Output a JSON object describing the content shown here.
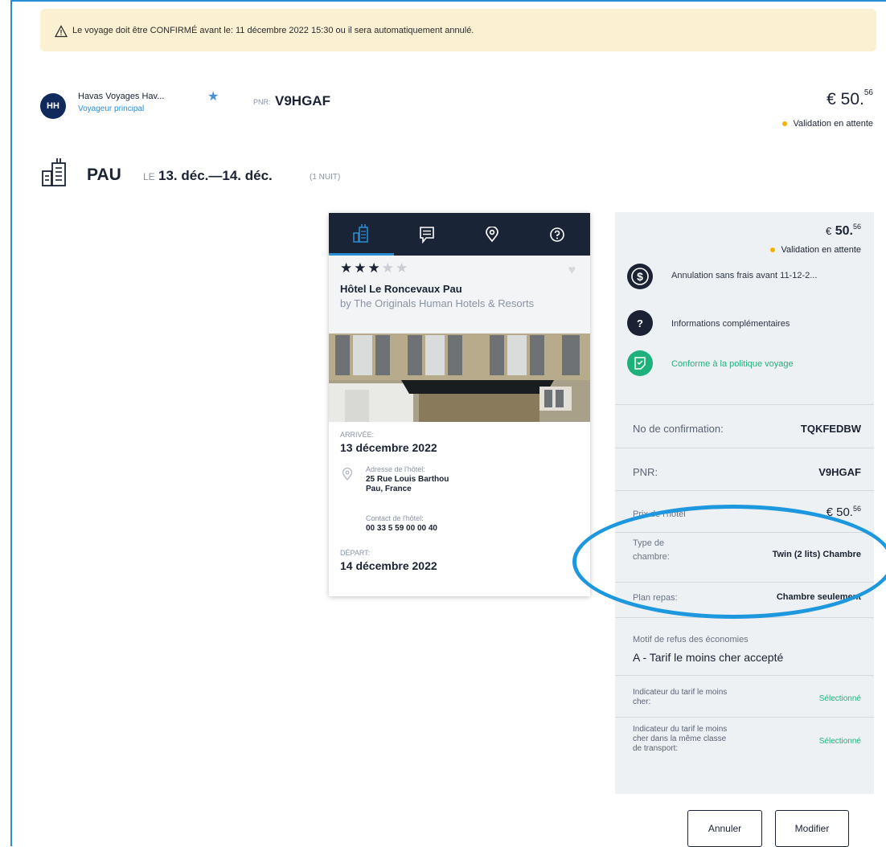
{
  "banner": {
    "text": "Le voyage doit être CONFIRMÉ avant le: 11 décembre 2022 15:30 ou il sera automatiquement annulé."
  },
  "traveler": {
    "initials": "HH",
    "name": "Havas Voyages Hav...",
    "role": "Voyageur principal"
  },
  "pnr": {
    "label": "PNR:",
    "value": "V9HGAF"
  },
  "price_top": {
    "currency": "€",
    "main": "50.",
    "cents": "56"
  },
  "status": "Validation en attente",
  "segment": {
    "city": "PAU",
    "le": "LE",
    "dates": "13. déc.—14. déc.",
    "nights": "(1 NUIT)"
  },
  "hotel": {
    "stars_filled": 3,
    "stars_total": 5,
    "stars_on": "★★★",
    "stars_off": "★★",
    "name": "Hôtel Le Roncevaux Pau",
    "chain": "by The Originals Human Hotels & Resorts",
    "arrival_label": "ARRIVÉE:",
    "arrival_date": "13 décembre 2022",
    "address_label": "Adresse de l'hôtel:",
    "address_line1": "25 Rue Louis Barthou",
    "address_line2": "Pau, France",
    "contact_label": "Contact de l'hôtel:",
    "contact_phone": "00 33 5 59 00 00 40",
    "departure_label": "DÉPART:",
    "departure_date": "14 décembre 2022"
  },
  "panel": {
    "price_currency": "€",
    "price_main": "50.",
    "price_cents": "56",
    "status": "Validation en attente",
    "cancellation": "Annulation sans frais avant 11-12-2...",
    "info": "Informations complémentaires",
    "policy": "Conforme à la politique voyage",
    "rows": {
      "confirmation_label": "No de confirmation:",
      "confirmation_value": "TQKFEDBW",
      "pnr_label": "PNR:",
      "pnr_value": "V9HGAF",
      "price_label": "Prix de l'hôtel",
      "price_currency": "€",
      "price_main": "50.",
      "price_cents": "56",
      "room_label_1": "Type de",
      "room_label_2": "chambre:",
      "room_value": "Twin (2 lits) Chambre",
      "meal_label": "Plan repas:",
      "meal_value": "Chambre seulement",
      "refusal_label": "Motif de refus des économies",
      "refusal_value": "A - Tarif le moins cher accepté",
      "lowest_label_1": "Indicateur du tarif le moins",
      "lowest_label_2": "cher:",
      "lowest_value": "Sélectionné",
      "lowest_class_label_1": "Indicateur du tarif le moins",
      "lowest_class_label_2": "cher dans la même classe",
      "lowest_class_label_3": "de transport:",
      "lowest_class_value": "Sélectionné"
    }
  },
  "buttons": {
    "cancel": "Annuler",
    "modify": "Modifier"
  },
  "colors": {
    "accent": "#2a8ed6",
    "dark": "#1a2437",
    "pending": "#f2b300",
    "ok": "#1fb17b",
    "highlight": "#1d98df"
  }
}
